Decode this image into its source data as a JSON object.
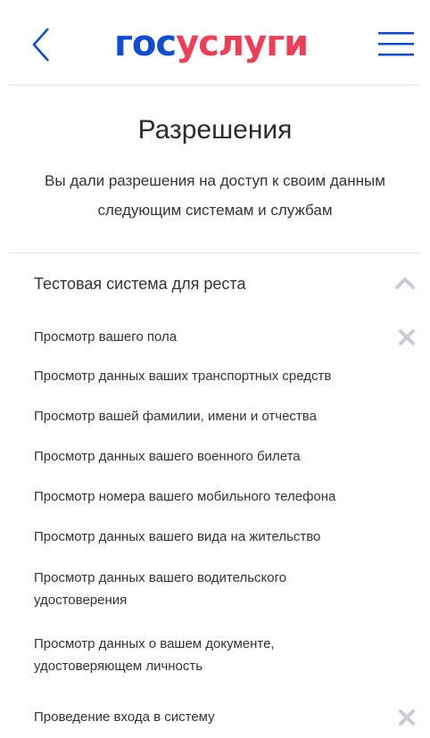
{
  "header": {
    "logo_part1": "гос",
    "logo_part2": "услуги",
    "back_icon": "chevron-left-icon",
    "menu_icon": "hamburger-menu-icon"
  },
  "page": {
    "title": "Разрешения",
    "description": "Вы дали разрешения на доступ к своим данным следующим системам и службам"
  },
  "system": {
    "name": "Тестовая система для реста",
    "expanded_icon": "chevron-up-icon",
    "permissions": [
      "Просмотр вашего пола",
      "Просмотр данных ваших транспортных средств",
      "Просмотр вашей фамилии, имени и отчества",
      "Просмотр данных вашего военного билета",
      "Просмотр номера вашего мобильного телефона",
      "Просмотр данных вашего вида на жительство",
      "Просмотр данных вашего водительского удостоверения",
      "Просмотр данных о вашем документе, удостоверяющем личность"
    ],
    "login_permission": "Проведение входа в систему"
  },
  "colors": {
    "brand_blue": "#0d4cd3",
    "brand_red": "#ee3f58",
    "icon_gray": "#c8cbd0"
  }
}
